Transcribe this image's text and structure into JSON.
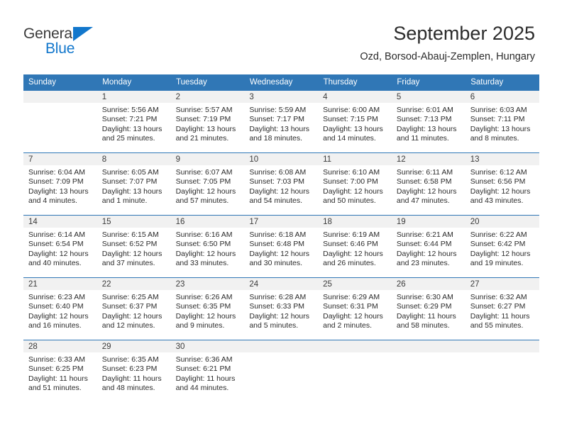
{
  "brand": {
    "name_part1": "General",
    "name_part2": "Blue",
    "accent_color": "#1277cc"
  },
  "header": {
    "title": "September 2025",
    "subtitle": "Ozd, Borsod-Abauj-Zemplen, Hungary"
  },
  "theme": {
    "header_blue": "#3077b6",
    "daynum_gray": "#f1f1f1",
    "text_color": "#2b2b2b"
  },
  "weekday_headers": [
    "Sunday",
    "Monday",
    "Tuesday",
    "Wednesday",
    "Thursday",
    "Friday",
    "Saturday"
  ],
  "weeks": [
    [
      {
        "day": "",
        "sunrise": "",
        "sunset": "",
        "daylight_line1": "",
        "daylight_line2": ""
      },
      {
        "day": "1",
        "sunrise": "Sunrise: 5:56 AM",
        "sunset": "Sunset: 7:21 PM",
        "daylight_line1": "Daylight: 13 hours",
        "daylight_line2": "and 25 minutes."
      },
      {
        "day": "2",
        "sunrise": "Sunrise: 5:57 AM",
        "sunset": "Sunset: 7:19 PM",
        "daylight_line1": "Daylight: 13 hours",
        "daylight_line2": "and 21 minutes."
      },
      {
        "day": "3",
        "sunrise": "Sunrise: 5:59 AM",
        "sunset": "Sunset: 7:17 PM",
        "daylight_line1": "Daylight: 13 hours",
        "daylight_line2": "and 18 minutes."
      },
      {
        "day": "4",
        "sunrise": "Sunrise: 6:00 AM",
        "sunset": "Sunset: 7:15 PM",
        "daylight_line1": "Daylight: 13 hours",
        "daylight_line2": "and 14 minutes."
      },
      {
        "day": "5",
        "sunrise": "Sunrise: 6:01 AM",
        "sunset": "Sunset: 7:13 PM",
        "daylight_line1": "Daylight: 13 hours",
        "daylight_line2": "and 11 minutes."
      },
      {
        "day": "6",
        "sunrise": "Sunrise: 6:03 AM",
        "sunset": "Sunset: 7:11 PM",
        "daylight_line1": "Daylight: 13 hours",
        "daylight_line2": "and 8 minutes."
      }
    ],
    [
      {
        "day": "7",
        "sunrise": "Sunrise: 6:04 AM",
        "sunset": "Sunset: 7:09 PM",
        "daylight_line1": "Daylight: 13 hours",
        "daylight_line2": "and 4 minutes."
      },
      {
        "day": "8",
        "sunrise": "Sunrise: 6:05 AM",
        "sunset": "Sunset: 7:07 PM",
        "daylight_line1": "Daylight: 13 hours",
        "daylight_line2": "and 1 minute."
      },
      {
        "day": "9",
        "sunrise": "Sunrise: 6:07 AM",
        "sunset": "Sunset: 7:05 PM",
        "daylight_line1": "Daylight: 12 hours",
        "daylight_line2": "and 57 minutes."
      },
      {
        "day": "10",
        "sunrise": "Sunrise: 6:08 AM",
        "sunset": "Sunset: 7:03 PM",
        "daylight_line1": "Daylight: 12 hours",
        "daylight_line2": "and 54 minutes."
      },
      {
        "day": "11",
        "sunrise": "Sunrise: 6:10 AM",
        "sunset": "Sunset: 7:00 PM",
        "daylight_line1": "Daylight: 12 hours",
        "daylight_line2": "and 50 minutes."
      },
      {
        "day": "12",
        "sunrise": "Sunrise: 6:11 AM",
        "sunset": "Sunset: 6:58 PM",
        "daylight_line1": "Daylight: 12 hours",
        "daylight_line2": "and 47 minutes."
      },
      {
        "day": "13",
        "sunrise": "Sunrise: 6:12 AM",
        "sunset": "Sunset: 6:56 PM",
        "daylight_line1": "Daylight: 12 hours",
        "daylight_line2": "and 43 minutes."
      }
    ],
    [
      {
        "day": "14",
        "sunrise": "Sunrise: 6:14 AM",
        "sunset": "Sunset: 6:54 PM",
        "daylight_line1": "Daylight: 12 hours",
        "daylight_line2": "and 40 minutes."
      },
      {
        "day": "15",
        "sunrise": "Sunrise: 6:15 AM",
        "sunset": "Sunset: 6:52 PM",
        "daylight_line1": "Daylight: 12 hours",
        "daylight_line2": "and 37 minutes."
      },
      {
        "day": "16",
        "sunrise": "Sunrise: 6:16 AM",
        "sunset": "Sunset: 6:50 PM",
        "daylight_line1": "Daylight: 12 hours",
        "daylight_line2": "and 33 minutes."
      },
      {
        "day": "17",
        "sunrise": "Sunrise: 6:18 AM",
        "sunset": "Sunset: 6:48 PM",
        "daylight_line1": "Daylight: 12 hours",
        "daylight_line2": "and 30 minutes."
      },
      {
        "day": "18",
        "sunrise": "Sunrise: 6:19 AM",
        "sunset": "Sunset: 6:46 PM",
        "daylight_line1": "Daylight: 12 hours",
        "daylight_line2": "and 26 minutes."
      },
      {
        "day": "19",
        "sunrise": "Sunrise: 6:21 AM",
        "sunset": "Sunset: 6:44 PM",
        "daylight_line1": "Daylight: 12 hours",
        "daylight_line2": "and 23 minutes."
      },
      {
        "day": "20",
        "sunrise": "Sunrise: 6:22 AM",
        "sunset": "Sunset: 6:42 PM",
        "daylight_line1": "Daylight: 12 hours",
        "daylight_line2": "and 19 minutes."
      }
    ],
    [
      {
        "day": "21",
        "sunrise": "Sunrise: 6:23 AM",
        "sunset": "Sunset: 6:40 PM",
        "daylight_line1": "Daylight: 12 hours",
        "daylight_line2": "and 16 minutes."
      },
      {
        "day": "22",
        "sunrise": "Sunrise: 6:25 AM",
        "sunset": "Sunset: 6:37 PM",
        "daylight_line1": "Daylight: 12 hours",
        "daylight_line2": "and 12 minutes."
      },
      {
        "day": "23",
        "sunrise": "Sunrise: 6:26 AM",
        "sunset": "Sunset: 6:35 PM",
        "daylight_line1": "Daylight: 12 hours",
        "daylight_line2": "and 9 minutes."
      },
      {
        "day": "24",
        "sunrise": "Sunrise: 6:28 AM",
        "sunset": "Sunset: 6:33 PM",
        "daylight_line1": "Daylight: 12 hours",
        "daylight_line2": "and 5 minutes."
      },
      {
        "day": "25",
        "sunrise": "Sunrise: 6:29 AM",
        "sunset": "Sunset: 6:31 PM",
        "daylight_line1": "Daylight: 12 hours",
        "daylight_line2": "and 2 minutes."
      },
      {
        "day": "26",
        "sunrise": "Sunrise: 6:30 AM",
        "sunset": "Sunset: 6:29 PM",
        "daylight_line1": "Daylight: 11 hours",
        "daylight_line2": "and 58 minutes."
      },
      {
        "day": "27",
        "sunrise": "Sunrise: 6:32 AM",
        "sunset": "Sunset: 6:27 PM",
        "daylight_line1": "Daylight: 11 hours",
        "daylight_line2": "and 55 minutes."
      }
    ],
    [
      {
        "day": "28",
        "sunrise": "Sunrise: 6:33 AM",
        "sunset": "Sunset: 6:25 PM",
        "daylight_line1": "Daylight: 11 hours",
        "daylight_line2": "and 51 minutes."
      },
      {
        "day": "29",
        "sunrise": "Sunrise: 6:35 AM",
        "sunset": "Sunset: 6:23 PM",
        "daylight_line1": "Daylight: 11 hours",
        "daylight_line2": "and 48 minutes."
      },
      {
        "day": "30",
        "sunrise": "Sunrise: 6:36 AM",
        "sunset": "Sunset: 6:21 PM",
        "daylight_line1": "Daylight: 11 hours",
        "daylight_line2": "and 44 minutes."
      },
      {
        "day": "",
        "sunrise": "",
        "sunset": "",
        "daylight_line1": "",
        "daylight_line2": ""
      },
      {
        "day": "",
        "sunrise": "",
        "sunset": "",
        "daylight_line1": "",
        "daylight_line2": ""
      },
      {
        "day": "",
        "sunrise": "",
        "sunset": "",
        "daylight_line1": "",
        "daylight_line2": ""
      },
      {
        "day": "",
        "sunrise": "",
        "sunset": "",
        "daylight_line1": "",
        "daylight_line2": ""
      }
    ]
  ]
}
